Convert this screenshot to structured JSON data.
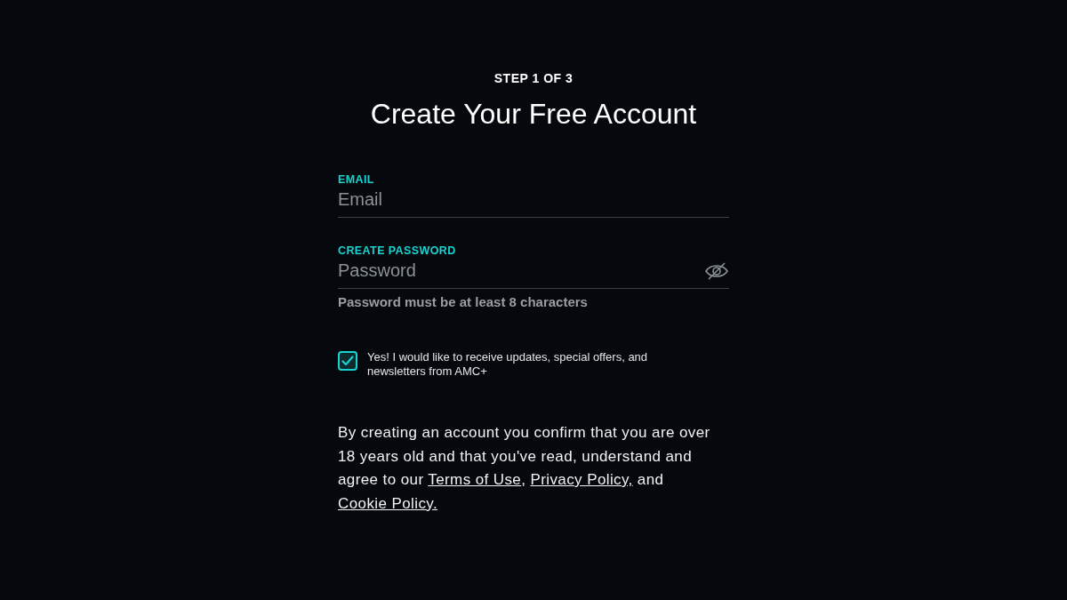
{
  "step": "STEP 1 OF 3",
  "title": "Create Your Free Account",
  "fields": [
    {
      "label": "EMAIL",
      "placeholder": "Email",
      "kind": "email"
    },
    {
      "label": "CREATE PASSWORD",
      "placeholder": "Password",
      "kind": "password",
      "hint": "Password must be at least 8 characters"
    }
  ],
  "newsletter": {
    "checked": true,
    "label": "Yes! I would like to receive updates, special offers, and newsletters from AMC+"
  },
  "legal": [
    {
      "kind": "text",
      "text": "By creating an account you confirm that you are over 18 years old and that you've read, understand and agree to our "
    },
    {
      "kind": "link",
      "text": "Terms of Use"
    },
    {
      "kind": "text",
      "text": ", "
    },
    {
      "kind": "link",
      "text": "Privacy Policy,"
    },
    {
      "kind": "text",
      "text": " and "
    },
    {
      "kind": "link",
      "text": "Cookie Policy."
    }
  ]
}
